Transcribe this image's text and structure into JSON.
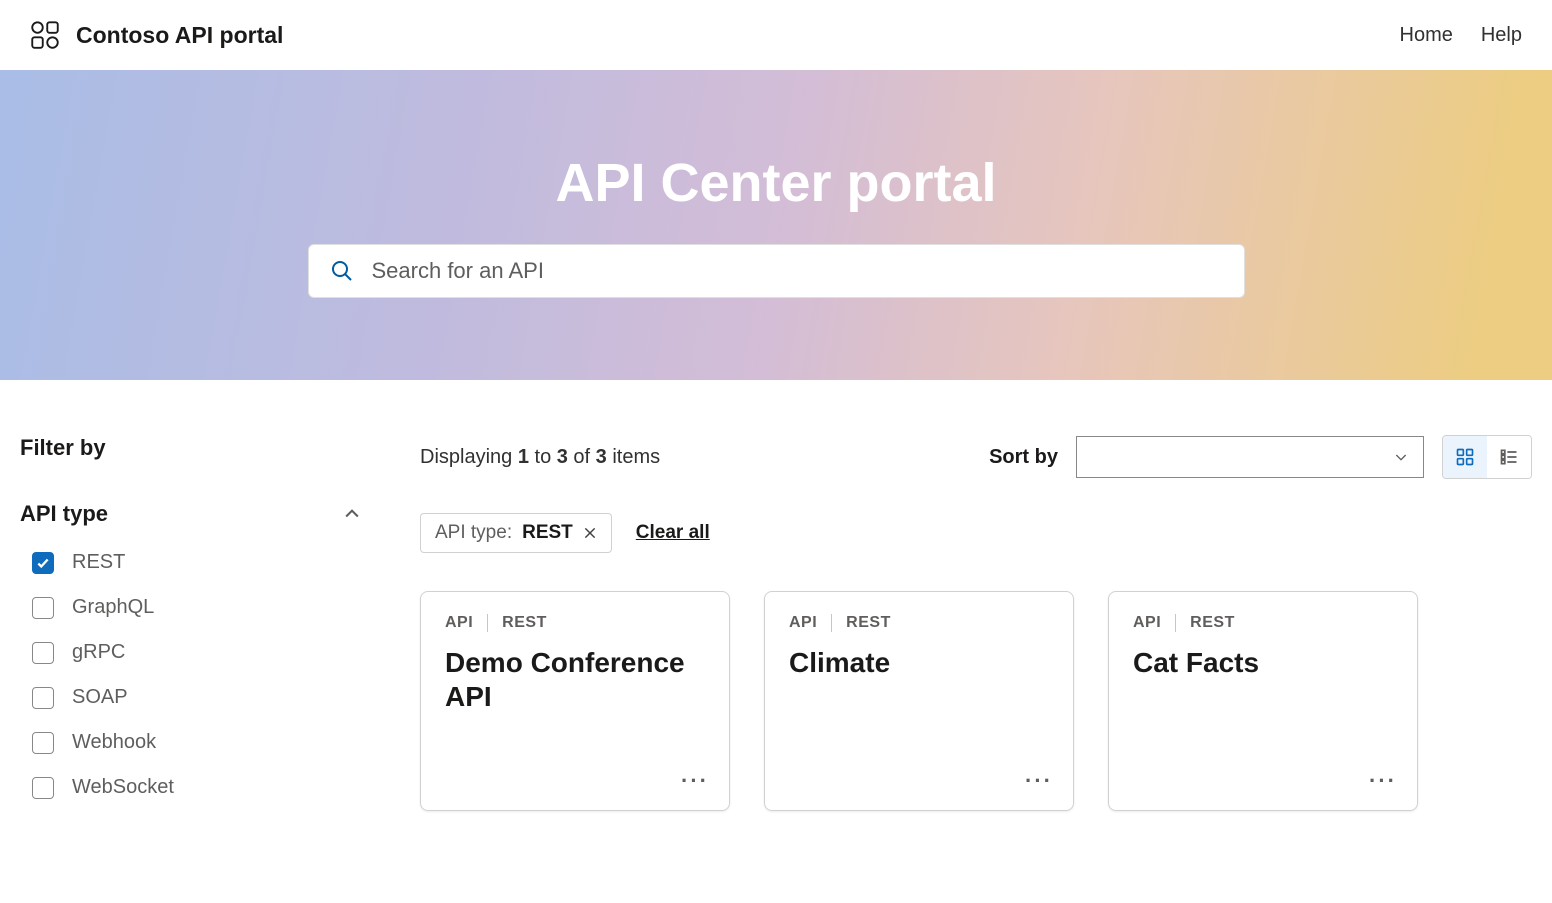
{
  "nav": {
    "title": "Contoso API portal",
    "links": [
      "Home",
      "Help"
    ]
  },
  "hero": {
    "title": "API Center portal",
    "search_placeholder": "Search for an API"
  },
  "sidebar": {
    "filter_header": "Filter by",
    "group_title": "API type",
    "options": [
      {
        "label": "REST",
        "checked": true
      },
      {
        "label": "GraphQL",
        "checked": false
      },
      {
        "label": "gRPC",
        "checked": false
      },
      {
        "label": "SOAP",
        "checked": false
      },
      {
        "label": "Webhook",
        "checked": false
      },
      {
        "label": "WebSocket",
        "checked": false
      }
    ]
  },
  "toolbar": {
    "displaying_prefix": "Displaying ",
    "from": "1",
    "to_word": " to ",
    "to": "3",
    "of_word": " of ",
    "total": "3",
    "items_word": " items",
    "sort_label": "Sort by",
    "sort_value": ""
  },
  "filters": {
    "chip_label": "API type: ",
    "chip_value": "REST",
    "clear_all": "Clear all"
  },
  "cards": [
    {
      "kind": "API",
      "type": "REST",
      "title": "Demo Conference API"
    },
    {
      "kind": "API",
      "type": "REST",
      "title": "Climate"
    },
    {
      "kind": "API",
      "type": "REST",
      "title": "Cat Facts"
    }
  ]
}
